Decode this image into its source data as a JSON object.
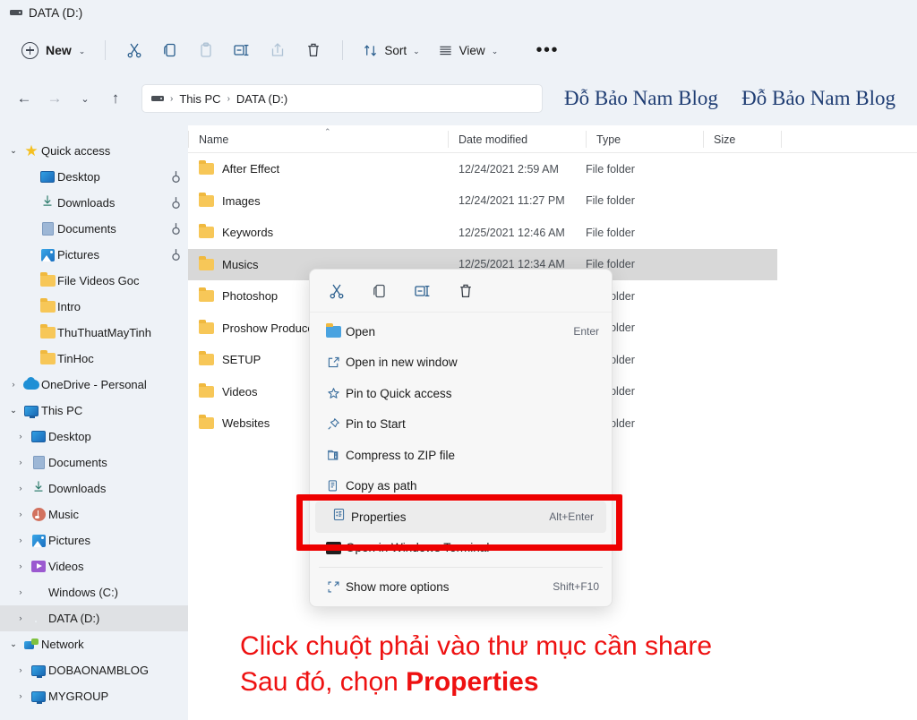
{
  "window": {
    "tab_title": "DATA (D:)",
    "drive_icon": "drive-icon"
  },
  "toolbar": {
    "new_label": "New",
    "new_chevron": "⌄",
    "cut_icon": "cut-icon",
    "copy_icon": "copy-icon",
    "paste_icon": "paste-icon",
    "rename_icon": "rename-icon",
    "share_icon": "share-icon",
    "delete_icon": "delete-icon",
    "sort_label": "Sort",
    "view_label": "View",
    "more_label": "•••"
  },
  "address": {
    "back_icon": "back-arrow-icon",
    "forward_icon": "forward-arrow-icon",
    "recent_icon": "chevron-down-icon",
    "up_icon": "up-arrow-icon",
    "crumbs": [
      "This PC",
      "DATA (D:)"
    ],
    "separator": "›"
  },
  "watermark": {
    "center": "Đỗ Bảo Nam Blog",
    "right": "Đỗ Bảo Nam Blog",
    "color": "#1f3d73"
  },
  "sidebar": {
    "items": [
      {
        "label": "Quick access",
        "icon": "star-icon",
        "chevron": "open",
        "indent": 0,
        "pinned": false,
        "selected": false
      },
      {
        "label": "Desktop",
        "icon": "desktop-icon",
        "chevron": "none",
        "indent": 1,
        "pinned": true,
        "selected": false
      },
      {
        "label": "Downloads",
        "icon": "download-icon",
        "chevron": "none",
        "indent": 1,
        "pinned": true,
        "selected": false
      },
      {
        "label": "Documents",
        "icon": "document-icon",
        "chevron": "none",
        "indent": 1,
        "pinned": true,
        "selected": false
      },
      {
        "label": "Pictures",
        "icon": "picture-icon",
        "chevron": "none",
        "indent": 1,
        "pinned": true,
        "selected": false
      },
      {
        "label": "File Videos Goc",
        "icon": "folder-icon",
        "chevron": "none",
        "indent": 1,
        "pinned": false,
        "selected": false
      },
      {
        "label": "Intro",
        "icon": "folder-icon",
        "chevron": "none",
        "indent": 1,
        "pinned": false,
        "selected": false
      },
      {
        "label": "ThuThuatMayTinh",
        "icon": "folder-icon",
        "chevron": "none",
        "indent": 1,
        "pinned": false,
        "selected": false
      },
      {
        "label": "TinHoc",
        "icon": "folder-icon",
        "chevron": "none",
        "indent": 1,
        "pinned": false,
        "selected": false
      },
      {
        "label": "OneDrive - Personal",
        "icon": "cloud-icon",
        "chevron": "closed",
        "indent": 0,
        "pinned": false,
        "selected": false
      },
      {
        "label": "This PC",
        "icon": "pc-icon",
        "chevron": "open",
        "indent": 0,
        "pinned": false,
        "selected": false
      },
      {
        "label": "Desktop",
        "icon": "desktop-icon",
        "chevron": "closed",
        "indent": 1,
        "pinned": false,
        "selected": false
      },
      {
        "label": "Documents",
        "icon": "document-icon",
        "chevron": "closed",
        "indent": 1,
        "pinned": false,
        "selected": false
      },
      {
        "label": "Downloads",
        "icon": "download-icon",
        "chevron": "closed",
        "indent": 1,
        "pinned": false,
        "selected": false
      },
      {
        "label": "Music",
        "icon": "music-icon",
        "chevron": "closed",
        "indent": 1,
        "pinned": false,
        "selected": false
      },
      {
        "label": "Pictures",
        "icon": "picture-icon",
        "chevron": "closed",
        "indent": 1,
        "pinned": false,
        "selected": false
      },
      {
        "label": "Videos",
        "icon": "video-icon",
        "chevron": "closed",
        "indent": 1,
        "pinned": false,
        "selected": false
      },
      {
        "label": "Windows (C:)",
        "icon": "drive-icon",
        "chevron": "closed",
        "indent": 1,
        "pinned": false,
        "selected": false
      },
      {
        "label": "DATA (D:)",
        "icon": "drive-icon",
        "chevron": "closed",
        "indent": 1,
        "pinned": false,
        "selected": true
      },
      {
        "label": "Network",
        "icon": "network-icon",
        "chevron": "open",
        "indent": 0,
        "pinned": false,
        "selected": false
      },
      {
        "label": "DOBAONAMBLOG",
        "icon": "pc-icon",
        "chevron": "closed",
        "indent": 1,
        "pinned": false,
        "selected": false
      },
      {
        "label": "MYGROUP",
        "icon": "pc-icon",
        "chevron": "closed",
        "indent": 1,
        "pinned": false,
        "selected": false
      }
    ]
  },
  "filelist": {
    "columns": [
      "Name",
      "Date modified",
      "Type",
      "Size"
    ],
    "sort_indicator": "⌃",
    "rows": [
      {
        "name": "After Effect",
        "date": "12/24/2021 2:59 AM",
        "type": "File folder",
        "size": "",
        "selected": false
      },
      {
        "name": "Images",
        "date": "12/24/2021 11:27 PM",
        "type": "File folder",
        "size": "",
        "selected": false
      },
      {
        "name": "Keywords",
        "date": "12/25/2021 12:46 AM",
        "type": "File folder",
        "size": "",
        "selected": false
      },
      {
        "name": "Musics",
        "date": "12/25/2021 12:34 AM",
        "type": "File folder",
        "size": "",
        "selected": true
      },
      {
        "name": "Photoshop",
        "date": "",
        "type": "File folder",
        "size": "",
        "selected": false
      },
      {
        "name": "Proshow Produce",
        "date": "",
        "type": "File folder",
        "size": "",
        "selected": false
      },
      {
        "name": "SETUP",
        "date": "",
        "type": "File folder",
        "size": "",
        "selected": false
      },
      {
        "name": "Videos",
        "date": "",
        "type": "File folder",
        "size": "",
        "selected": false
      },
      {
        "name": "Websites",
        "date": "",
        "type": "File folder",
        "size": "",
        "selected": false
      }
    ]
  },
  "context_menu": {
    "quick_actions": [
      {
        "icon": "cut-icon",
        "label": "Cut"
      },
      {
        "icon": "copy-icon",
        "label": "Copy"
      },
      {
        "icon": "rename-icon",
        "label": "Rename"
      },
      {
        "icon": "delete-icon",
        "label": "Delete"
      }
    ],
    "items": [
      {
        "label": "Open",
        "icon": "folder-open-icon",
        "accel": "Enter",
        "highlight": false
      },
      {
        "label": "Open in new window",
        "icon": "new-window-icon",
        "accel": "",
        "highlight": false
      },
      {
        "label": "Pin to Quick access",
        "icon": "star-outline-icon",
        "accel": "",
        "highlight": false
      },
      {
        "label": "Pin to Start",
        "icon": "pin-icon",
        "accel": "",
        "highlight": false
      },
      {
        "label": "Compress to ZIP file",
        "icon": "zip-icon",
        "accel": "",
        "highlight": false
      },
      {
        "label": "Copy as path",
        "icon": "copy-path-icon",
        "accel": "",
        "highlight": false
      },
      {
        "label": "Properties",
        "icon": "properties-icon",
        "accel": "Alt+Enter",
        "highlight": true
      },
      {
        "label": "Open in Windows Terminal",
        "icon": "terminal-icon",
        "accel": "",
        "highlight": false
      },
      {
        "label": "Show more options",
        "icon": "more-options-icon",
        "accel": "Shift+F10",
        "highlight": false
      }
    ]
  },
  "annotation": {
    "line1": "Click chuột phải vào thư mục cần share",
    "line2_prefix": "Sau đó, chọn ",
    "line2_bold": "Properties",
    "color": "#ee1111",
    "highlight_box_color": "#ee0000"
  }
}
